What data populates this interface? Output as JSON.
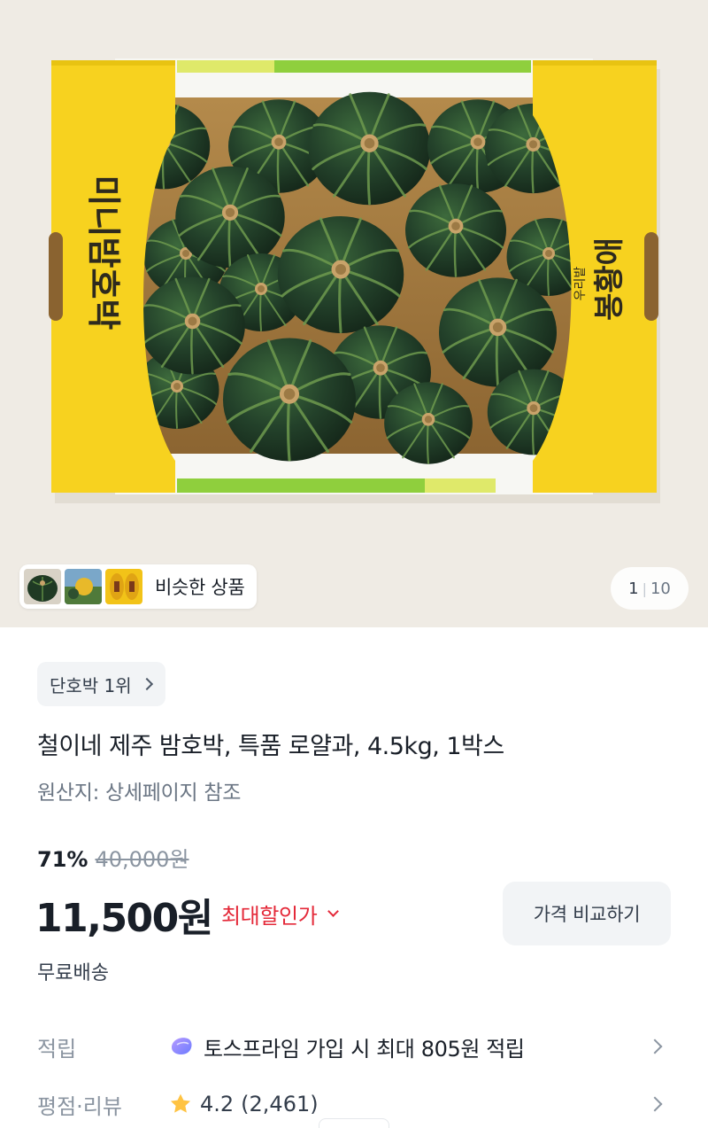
{
  "gallery": {
    "similar_label": "비슷한 상품",
    "page_current": "1",
    "page_total": "10",
    "box_text_left": "미니밤호박",
    "box_text_right": "봉황애",
    "box_text_right_small": "우리밭"
  },
  "product": {
    "rank_label": "단호박 1위",
    "title": "철이네 제주 밤호박, 특품 로얄과, 4.5kg, 1박스",
    "origin": "원산지: 상세페이지 참조",
    "discount_rate": "71%",
    "original_price": "40,000원",
    "price": "11,500원",
    "max_discount_label": "최대할인가",
    "compare_button": "가격 비교하기",
    "shipping": "무료배송"
  },
  "points": {
    "label": "적립",
    "text": "토스프라임 가입 시 최대 805원 적립"
  },
  "review": {
    "label": "평점·리뷰",
    "rating": "4.2",
    "count": "(2,461)"
  },
  "colors": {
    "accent_red": "#e42939",
    "box_yellow": "#f7d21f",
    "pumpkin_green": "#1f3a24",
    "background": "#efebe4"
  }
}
